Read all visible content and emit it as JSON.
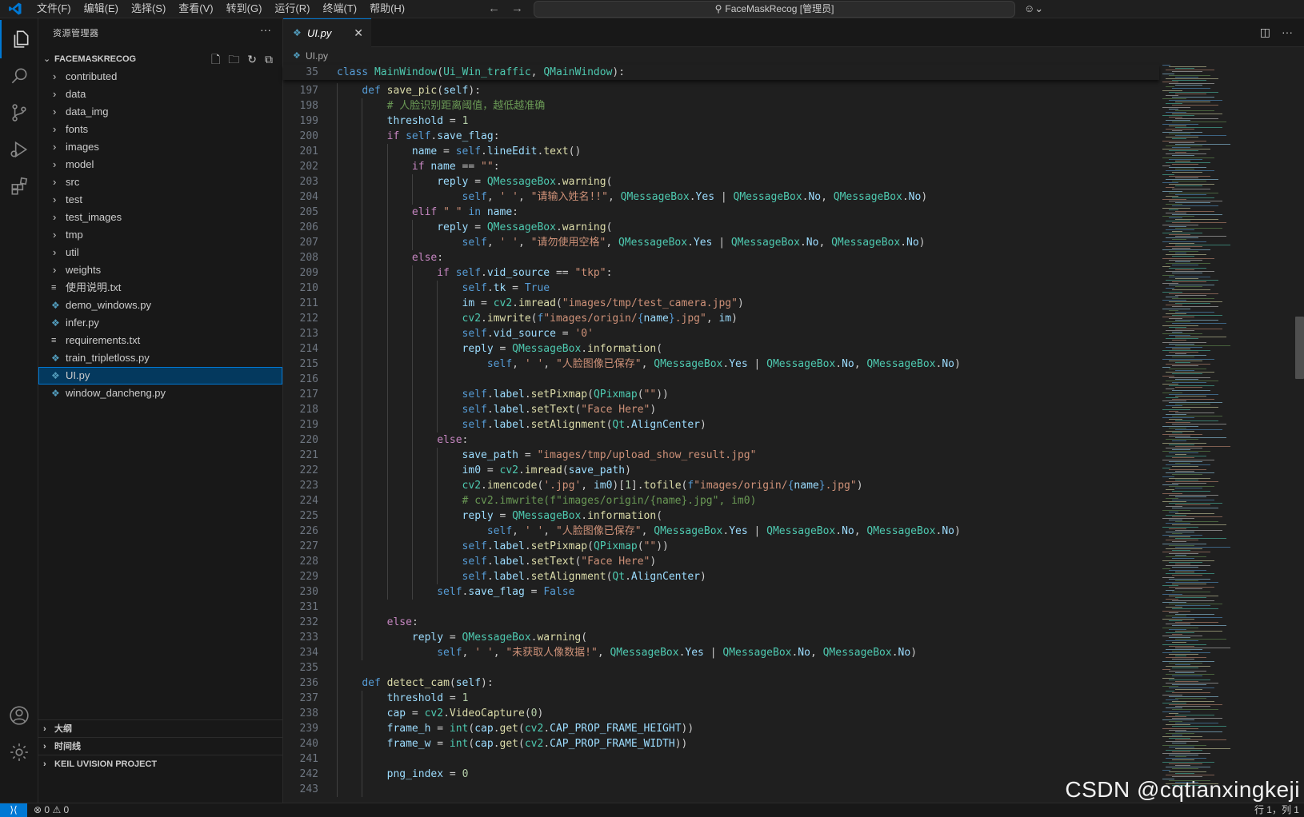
{
  "window": {
    "title": "FaceMaskRecog [管理员]",
    "menu": [
      "文件(F)",
      "编辑(E)",
      "选择(S)",
      "查看(V)",
      "转到(G)",
      "运行(R)",
      "终端(T)",
      "帮助(H)"
    ]
  },
  "sidebar": {
    "title": "资源管理器",
    "folder": "FACEMASKRECOG",
    "items": [
      {
        "label": "contributed",
        "type": "folder"
      },
      {
        "label": "data",
        "type": "folder"
      },
      {
        "label": "data_img",
        "type": "folder"
      },
      {
        "label": "fonts",
        "type": "folder"
      },
      {
        "label": "images",
        "type": "folder"
      },
      {
        "label": "model",
        "type": "folder"
      },
      {
        "label": "src",
        "type": "folder"
      },
      {
        "label": "test",
        "type": "folder"
      },
      {
        "label": "test_images",
        "type": "folder"
      },
      {
        "label": "tmp",
        "type": "folder"
      },
      {
        "label": "util",
        "type": "folder"
      },
      {
        "label": "weights",
        "type": "folder"
      },
      {
        "label": "使用说明.txt",
        "type": "txt"
      },
      {
        "label": "demo_windows.py",
        "type": "py"
      },
      {
        "label": "infer.py",
        "type": "py"
      },
      {
        "label": "requirements.txt",
        "type": "txt"
      },
      {
        "label": "train_tripletloss.py",
        "type": "py"
      },
      {
        "label": "UI.py",
        "type": "py",
        "selected": true
      },
      {
        "label": "window_dancheng.py",
        "type": "py"
      }
    ],
    "sections": [
      "大纲",
      "时间线",
      "KEIL UVISION PROJECT"
    ]
  },
  "editor": {
    "tab": "UI.py",
    "breadcrumb": "UI.py",
    "sticky": {
      "num": "35",
      "html": "<span class=\"kw\">class</span> <span class=\"cls\">MainWindow</span>(<span class=\"cls\">Ui_Win_traffic</span>, <span class=\"cls\">QMainWindow</span>):"
    },
    "lines": [
      {
        "num": "197",
        "html": "    <span class=\"kw\">def</span> <span class=\"fn\">save_pic</span>(<span class=\"var\">self</span>):"
      },
      {
        "num": "198",
        "html": "        <span class=\"cmt\"># 人脸识别距离阈值，越低越准确</span>"
      },
      {
        "num": "199",
        "html": "        <span class=\"var\">threshold</span> = <span class=\"num\">1</span>"
      },
      {
        "num": "200",
        "html": "        <span class=\"ctl\">if</span> <span class=\"kw\">self</span>.<span class=\"var\">save_flag</span>:"
      },
      {
        "num": "201",
        "html": "            <span class=\"var\">name</span> = <span class=\"kw\">self</span>.<span class=\"var\">lineEdit</span>.<span class=\"fn\">text</span>()"
      },
      {
        "num": "202",
        "html": "            <span class=\"ctl\">if</span> <span class=\"var\">name</span> == <span class=\"str\">\"\"</span>:"
      },
      {
        "num": "203",
        "html": "                <span class=\"var\">reply</span> = <span class=\"cls\">QMessageBox</span>.<span class=\"fn\">warning</span>("
      },
      {
        "num": "204",
        "html": "                    <span class=\"kw\">self</span>, <span class=\"str\">' '</span>, <span class=\"str\">\"请输入姓名!!\"</span>, <span class=\"cls\">QMessageBox</span>.<span class=\"var\">Yes</span> | <span class=\"cls\">QMessageBox</span>.<span class=\"var\">No</span>, <span class=\"cls\">QMessageBox</span>.<span class=\"var\">No</span>)"
      },
      {
        "num": "205",
        "html": "            <span class=\"ctl\">elif</span> <span class=\"str\">\" \"</span> <span class=\"kw\">in</span> <span class=\"var\">name</span>:"
      },
      {
        "num": "206",
        "html": "                <span class=\"var\">reply</span> = <span class=\"cls\">QMessageBox</span>.<span class=\"fn\">warning</span>("
      },
      {
        "num": "207",
        "html": "                    <span class=\"kw\">self</span>, <span class=\"str\">' '</span>, <span class=\"str\">\"请勿使用空格\"</span>, <span class=\"cls\">QMessageBox</span>.<span class=\"var\">Yes</span> | <span class=\"cls\">QMessageBox</span>.<span class=\"var\">No</span>, <span class=\"cls\">QMessageBox</span>.<span class=\"var\">No</span>)"
      },
      {
        "num": "208",
        "html": "            <span class=\"ctl\">else</span>:"
      },
      {
        "num": "209",
        "html": "                <span class=\"ctl\">if</span> <span class=\"kw\">self</span>.<span class=\"var\">vid_source</span> == <span class=\"str\">\"tkp\"</span>:"
      },
      {
        "num": "210",
        "html": "                    <span class=\"kw\">self</span>.<span class=\"var\">tk</span> = <span class=\"kw\">True</span>"
      },
      {
        "num": "211",
        "html": "                    <span class=\"var\">im</span> = <span class=\"cls\">cv2</span>.<span class=\"fn\">imread</span>(<span class=\"str\">\"images/tmp/test_camera.jpg\"</span>)"
      },
      {
        "num": "212",
        "html": "                    <span class=\"cls\">cv2</span>.<span class=\"fn\">imwrite</span>(<span class=\"kw\">f</span><span class=\"str\">\"images/origin/</span><span class=\"kw\">{</span><span class=\"var\">name</span><span class=\"kw\">}</span><span class=\"str\">.jpg\"</span>, <span class=\"var\">im</span>)"
      },
      {
        "num": "213",
        "html": "                    <span class=\"kw\">self</span>.<span class=\"var\">vid_source</span> = <span class=\"str\">'0'</span>"
      },
      {
        "num": "214",
        "html": "                    <span class=\"var\">reply</span> = <span class=\"cls\">QMessageBox</span>.<span class=\"fn\">information</span>("
      },
      {
        "num": "215",
        "html": "                        <span class=\"kw\">self</span>, <span class=\"str\">' '</span>, <span class=\"str\">\"人脸图像已保存\"</span>, <span class=\"cls\">QMessageBox</span>.<span class=\"var\">Yes</span> | <span class=\"cls\">QMessageBox</span>.<span class=\"var\">No</span>, <span class=\"cls\">QMessageBox</span>.<span class=\"var\">No</span>)"
      },
      {
        "num": "216",
        "html": ""
      },
      {
        "num": "217",
        "html": "                    <span class=\"kw\">self</span>.<span class=\"var\">label</span>.<span class=\"fn\">setPixmap</span>(<span class=\"cls\">QPixmap</span>(<span class=\"str\">\"\"</span>))"
      },
      {
        "num": "218",
        "html": "                    <span class=\"kw\">self</span>.<span class=\"var\">label</span>.<span class=\"fn\">setText</span>(<span class=\"str\">\"Face Here\"</span>)"
      },
      {
        "num": "219",
        "html": "                    <span class=\"kw\">self</span>.<span class=\"var\">label</span>.<span class=\"fn\">setAlignment</span>(<span class=\"cls\">Qt</span>.<span class=\"var\">AlignCenter</span>)"
      },
      {
        "num": "220",
        "html": "                <span class=\"ctl\">else</span>:"
      },
      {
        "num": "221",
        "html": "                    <span class=\"var\">save_path</span> = <span class=\"str\">\"images/tmp/upload_show_result.jpg\"</span>"
      },
      {
        "num": "222",
        "html": "                    <span class=\"var\">im0</span> = <span class=\"cls\">cv2</span>.<span class=\"fn\">imread</span>(<span class=\"var\">save_path</span>)"
      },
      {
        "num": "223",
        "html": "                    <span class=\"cls\">cv2</span>.<span class=\"fn\">imencode</span>(<span class=\"str\">'.jpg'</span>, <span class=\"var\">im0</span>)[<span class=\"num\">1</span>].<span class=\"fn\">tofile</span>(<span class=\"kw\">f</span><span class=\"str\">\"images/origin/</span><span class=\"kw\">{</span><span class=\"var\">name</span><span class=\"kw\">}</span><span class=\"str\">.jpg\"</span>)"
      },
      {
        "num": "224",
        "html": "                    <span class=\"cmt\"># cv2.imwrite(f\"images/origin/{name}.jpg\", im0)</span>"
      },
      {
        "num": "225",
        "html": "                    <span class=\"var\">reply</span> = <span class=\"cls\">QMessageBox</span>.<span class=\"fn\">information</span>("
      },
      {
        "num": "226",
        "html": "                        <span class=\"kw\">self</span>, <span class=\"str\">' '</span>, <span class=\"str\">\"人脸图像已保存\"</span>, <span class=\"cls\">QMessageBox</span>.<span class=\"var\">Yes</span> | <span class=\"cls\">QMessageBox</span>.<span class=\"var\">No</span>, <span class=\"cls\">QMessageBox</span>.<span class=\"var\">No</span>)"
      },
      {
        "num": "227",
        "html": "                    <span class=\"kw\">self</span>.<span class=\"var\">label</span>.<span class=\"fn\">setPixmap</span>(<span class=\"cls\">QPixmap</span>(<span class=\"str\">\"\"</span>))"
      },
      {
        "num": "228",
        "html": "                    <span class=\"kw\">self</span>.<span class=\"var\">label</span>.<span class=\"fn\">setText</span>(<span class=\"str\">\"Face Here\"</span>)"
      },
      {
        "num": "229",
        "html": "                    <span class=\"kw\">self</span>.<span class=\"var\">label</span>.<span class=\"fn\">setAlignment</span>(<span class=\"cls\">Qt</span>.<span class=\"var\">AlignCenter</span>)"
      },
      {
        "num": "230",
        "html": "                <span class=\"kw\">self</span>.<span class=\"var\">save_flag</span> = <span class=\"kw\">False</span>"
      },
      {
        "num": "231",
        "html": ""
      },
      {
        "num": "232",
        "html": "        <span class=\"ctl\">else</span>:"
      },
      {
        "num": "233",
        "html": "            <span class=\"var\">reply</span> = <span class=\"cls\">QMessageBox</span>.<span class=\"fn\">warning</span>("
      },
      {
        "num": "234",
        "html": "                <span class=\"kw\">self</span>, <span class=\"str\">' '</span>, <span class=\"str\">\"未获取人像数据!\"</span>, <span class=\"cls\">QMessageBox</span>.<span class=\"var\">Yes</span> | <span class=\"cls\">QMessageBox</span>.<span class=\"var\">No</span>, <span class=\"cls\">QMessageBox</span>.<span class=\"var\">No</span>)"
      },
      {
        "num": "235",
        "html": ""
      },
      {
        "num": "236",
        "html": "    <span class=\"kw\">def</span> <span class=\"fn\">detect_cam</span>(<span class=\"var\">self</span>):"
      },
      {
        "num": "237",
        "html": "        <span class=\"var\">threshold</span> = <span class=\"num\">1</span>"
      },
      {
        "num": "238",
        "html": "        <span class=\"var\">cap</span> = <span class=\"cls\">cv2</span>.<span class=\"fn\">VideoCapture</span>(<span class=\"num\">0</span>)"
      },
      {
        "num": "239",
        "html": "        <span class=\"var\">frame_h</span> = <span class=\"cls\">int</span>(<span class=\"var\">cap</span>.<span class=\"fn\">get</span>(<span class=\"cls\">cv2</span>.<span class=\"var\">CAP_PROP_FRAME_HEIGHT</span>))"
      },
      {
        "num": "240",
        "html": "        <span class=\"var\">frame_w</span> = <span class=\"cls\">int</span>(<span class=\"var\">cap</span>.<span class=\"fn\">get</span>(<span class=\"cls\">cv2</span>.<span class=\"var\">CAP_PROP_FRAME_WIDTH</span>))"
      },
      {
        "num": "241",
        "html": ""
      },
      {
        "num": "242",
        "html": "        <span class=\"var\">png_index</span> = <span class=\"num\">0</span>"
      },
      {
        "num": "243",
        "html": ""
      }
    ]
  },
  "statusbar": {
    "errors": "0",
    "warnings": "0",
    "cursor": "行 1，列 1"
  },
  "watermark": "CSDN @cqtianxingkeji",
  "colors": {
    "accent": "#0078d4",
    "keyword": "#569cd6",
    "function": "#dcdcaa",
    "class": "#4ec9b0",
    "string": "#ce9178",
    "comment": "#6a9955"
  }
}
